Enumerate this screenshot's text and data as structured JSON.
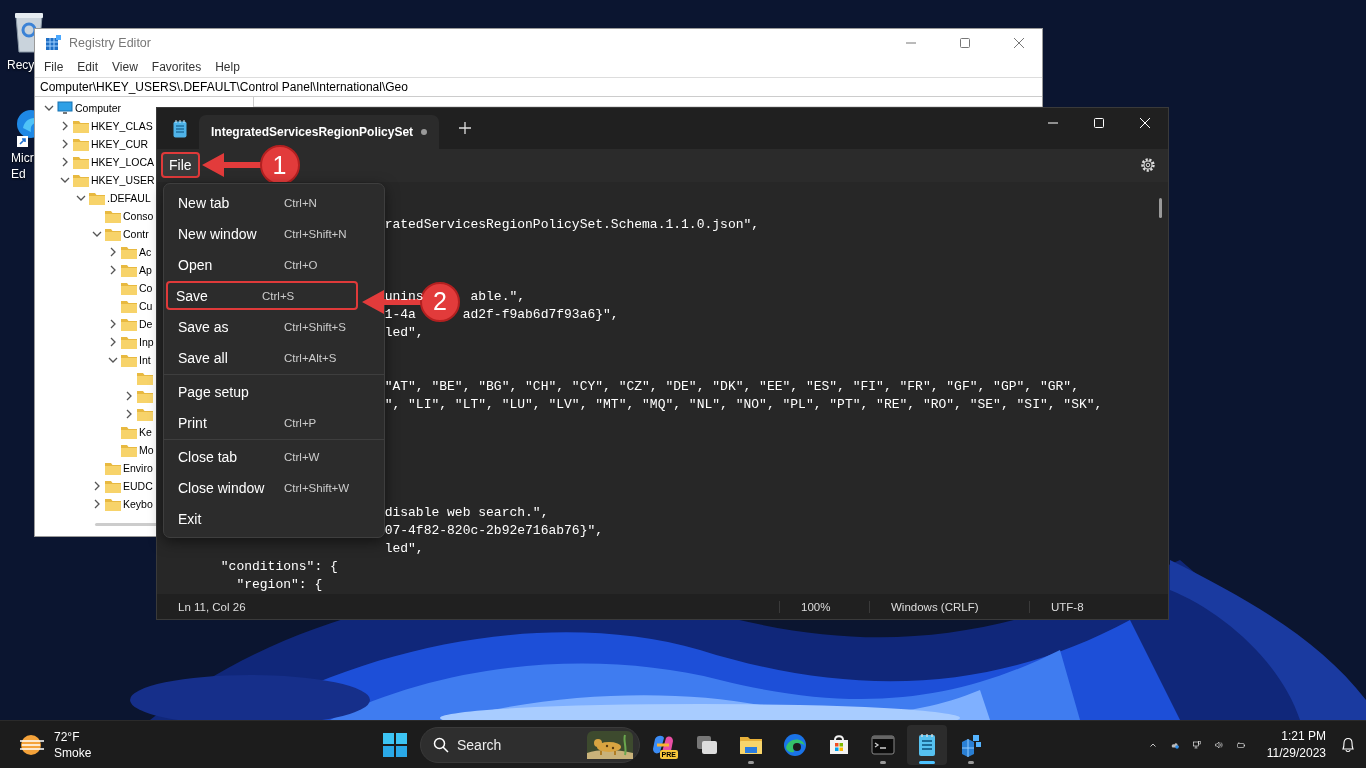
{
  "desktop": {
    "icons": [
      {
        "kind": "recycle-bin",
        "label_lines": [
          "Recy"
        ]
      },
      {
        "kind": "edge",
        "label_lines": [
          "Micr",
          "Ed"
        ]
      }
    ]
  },
  "registry_editor": {
    "title": "Registry Editor",
    "menu": [
      "File",
      "Edit",
      "View",
      "Favorites",
      "Help"
    ],
    "address": "Computer\\HKEY_USERS\\.DEFAULT\\Control Panel\\International\\Geo",
    "tree": [
      {
        "kind": "computer",
        "label": "Computer",
        "expanded": true,
        "children": [
          {
            "kind": "folder",
            "label": "HKEY_CLAS",
            "expanded": false
          },
          {
            "kind": "folder",
            "label": "HKEY_CUR",
            "expanded": false
          },
          {
            "kind": "folder",
            "label": "HKEY_LOCA",
            "expanded": false
          },
          {
            "kind": "folder",
            "label": "HKEY_USER",
            "expanded": true,
            "children": [
              {
                "kind": "folder",
                "label": ".DEFAUL",
                "expanded": true,
                "children": [
                  {
                    "kind": "folder",
                    "label": "Conso"
                  },
                  {
                    "kind": "folder",
                    "label": "Contr",
                    "expanded": true,
                    "children": [
                      {
                        "kind": "folder",
                        "label": "Ac",
                        "expanded": false
                      },
                      {
                        "kind": "folder",
                        "label": "Ap",
                        "expanded": false
                      },
                      {
                        "kind": "folder",
                        "label": "Co"
                      },
                      {
                        "kind": "folder",
                        "label": "Cu"
                      },
                      {
                        "kind": "folder",
                        "label": "De",
                        "expanded": false
                      },
                      {
                        "kind": "folder",
                        "label": "Inp",
                        "expanded": false
                      },
                      {
                        "kind": "folder",
                        "label": "Int",
                        "expanded": true,
                        "children": [
                          {
                            "kind": "folder"
                          },
                          {
                            "kind": "folder",
                            "expanded": false
                          },
                          {
                            "kind": "folder",
                            "expanded": false
                          }
                        ]
                      },
                      {
                        "kind": "folder",
                        "label": "Ke"
                      },
                      {
                        "kind": "folder",
                        "label": "Mo"
                      }
                    ]
                  },
                  {
                    "kind": "folder",
                    "label": "Enviro"
                  },
                  {
                    "kind": "folder",
                    "label": "EUDC",
                    "expanded": false
                  },
                  {
                    "kind": "folder",
                    "label": "Keybo",
                    "expanded": false
                  }
                ]
              }
            ]
          }
        ]
      }
    ]
  },
  "notepad": {
    "tabs": [
      {
        "title": "IntegratedServicesRegionPolicySet",
        "modified": true,
        "selected": true
      }
    ],
    "menu": [
      {
        "label": "File",
        "open": true,
        "callout": "1"
      }
    ],
    "lines": [
      {
        "kind": "blank"
      },
      {
        "kind": "clipped",
        "parts": [
          "ratedServicesRegionPolicySet.Schema.1.1.0.json\","
        ]
      },
      {
        "kind": "blank"
      },
      {
        "kind": "blank"
      },
      {
        "kind": "blank"
      },
      {
        "kind": "clipped",
        "parts": [
          "unins",
          "able.\","
        ]
      },
      {
        "kind": "clipped",
        "parts": [
          "1-4a",
          "ad2f-f9ab6d7f93a6}\","
        ]
      },
      {
        "kind": "clipped",
        "parts": [
          "led\","
        ]
      },
      {
        "kind": "blank"
      },
      {
        "kind": "blank"
      },
      {
        "kind": "clipped",
        "parts": [
          "\"AT\", \"BE\", \"BG\", \"CH\", \"CY\", \"CZ\", \"DE\", \"DK\", \"EE\", \"ES\", \"FI\", \"FR\", \"GF\", \"GP\", \"GR\","
        ]
      },
      {
        "kind": "clipped",
        "parts": [
          "\", \"LI\", \"LT\", \"LU\", \"LV\", \"MT\", \"MQ\", \"NL\", \"NO\", \"PL\", \"PT\", \"RE\", \"RO\", \"SE\", \"SI\", \"SK\","
        ]
      },
      {
        "kind": "blank"
      },
      {
        "kind": "blank"
      },
      {
        "kind": "blank"
      },
      {
        "kind": "blank"
      },
      {
        "kind": "blank"
      },
      {
        "kind": "clipped",
        "parts": [
          "disable web search.\","
        ]
      },
      {
        "kind": "clipped",
        "parts": [
          "07-4f82-820c-2b92e716ab76}\","
        ]
      },
      {
        "kind": "clipped",
        "parts": [
          "led\","
        ]
      },
      {
        "kind": "full",
        "text": "      \"conditions\": {"
      },
      {
        "kind": "full",
        "text": "        \"region\": {"
      }
    ],
    "status_bar": [
      "Ln 11, Col 26",
      "100%",
      "Windows (CRLF)",
      "UTF-8"
    ]
  },
  "file_menu": {
    "items": [
      {
        "kind": "item",
        "label": "New tab",
        "shortcut": "Ctrl+N"
      },
      {
        "kind": "item",
        "label": "New window",
        "shortcut": "Ctrl+Shift+N"
      },
      {
        "kind": "item",
        "label": "Open",
        "shortcut": "Ctrl+O"
      },
      {
        "kind": "item",
        "label": "Save",
        "shortcut": "Ctrl+S",
        "callout": "2"
      },
      {
        "kind": "item",
        "label": "Save as",
        "shortcut": "Ctrl+Shift+S"
      },
      {
        "kind": "item",
        "label": "Save all",
        "shortcut": "Ctrl+Alt+S"
      },
      {
        "kind": "separator"
      },
      {
        "kind": "item",
        "label": "Page setup"
      },
      {
        "kind": "item",
        "label": "Print",
        "shortcut": "Ctrl+P"
      },
      {
        "kind": "separator"
      },
      {
        "kind": "item",
        "label": "Close tab",
        "shortcut": "Ctrl+W"
      },
      {
        "kind": "item",
        "label": "Close window",
        "shortcut": "Ctrl+Shift+W"
      },
      {
        "kind": "item",
        "label": "Exit"
      }
    ]
  },
  "taskbar": {
    "weather": {
      "temperature": "72°F",
      "condition": "Smoke"
    },
    "search": {
      "placeholder": "Search"
    },
    "apps": [
      {
        "kind": "copilot",
        "badge": "PRE",
        "running": false,
        "active": false
      },
      {
        "kind": "task-view",
        "running": false,
        "active": false
      },
      {
        "kind": "folder",
        "running": true,
        "active": false
      },
      {
        "kind": "browser",
        "running": false,
        "active": false
      },
      {
        "kind": "store",
        "running": false,
        "active": false
      },
      {
        "kind": "terminal",
        "running": true,
        "active": false
      },
      {
        "kind": "notepad",
        "running": true,
        "active": true
      },
      {
        "kind": "registry",
        "running": true,
        "active": false
      }
    ],
    "tray": {
      "time": "1:21 PM",
      "date": "11/29/2023"
    }
  }
}
